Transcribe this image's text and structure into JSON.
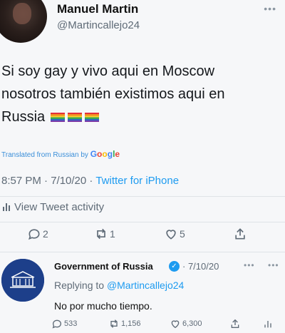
{
  "main_tweet": {
    "author_name": "Manuel Martin",
    "author_handle": "@Martincallejo24",
    "more_icon": "more-dots-icon",
    "text_line1": "Si soy gay y vivo aqui en Moscow",
    "text_line2": "nosotros también existimos aqui en",
    "text_line3": "Russia",
    "flags": [
      "rainbow-flag-emoji",
      "rainbow-flag-emoji",
      "rainbow-flag-emoji"
    ],
    "translated_label": "Translated from Russian by",
    "translator_brand": "Google",
    "timestamp": "8:57 PM · 7/10/20 ·",
    "source": "Twitter for iPhone",
    "activity_label": "View Tweet activity",
    "stats": {
      "replies": "2",
      "retweets": "1",
      "likes": "5"
    }
  },
  "reply_tweet": {
    "author_name": "Government of Russia",
    "date": "· 7/10/20",
    "replying_prefix": "Replying to",
    "replying_handle": "@Martincallejo24",
    "text": "No por mucho tiempo.",
    "stats": {
      "replies": "533",
      "retweets": "1,156",
      "likes": "6,300"
    }
  },
  "colors": {
    "accent": "#1d9bf0",
    "secondary_text": "#5f6b77",
    "background": "#f6f7f9"
  }
}
